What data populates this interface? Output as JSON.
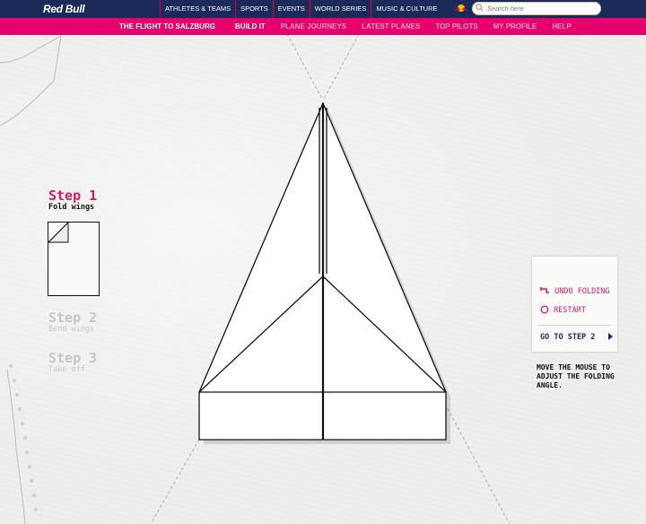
{
  "brand": {
    "logo": "Red Bull"
  },
  "topnav": {
    "items": [
      "ATHLETES & TEAMS",
      "SPORTS",
      "EVENTS",
      "WORLD SERIES",
      "MUSIC & CULTURE"
    ]
  },
  "search": {
    "placeholder": "Search here"
  },
  "subnav": {
    "title": "THE FLIGHT TO SALZBURG",
    "items": [
      "BUILD IT",
      "PLANE JOURNEYS",
      "LATEST PLANES",
      "TOP PILOTS",
      "MY PROFILE",
      "HELP"
    ],
    "active_index": 0
  },
  "steps": [
    {
      "title": "Step 1",
      "subtitle": "Fold wings",
      "active": true
    },
    {
      "title": "Step 2",
      "subtitle": "Bend wings",
      "active": false
    },
    {
      "title": "Step 3",
      "subtitle": "Take off",
      "active": false
    }
  ],
  "controls": {
    "undo_label": "UNDO FOLDING",
    "restart_label": "RESTART",
    "next_label": "GO TO STEP 2"
  },
  "instructions": "MOVE THE MOUSE TO ADJUST THE FOLDING ANGLE.",
  "colors": {
    "navy": "#1b2a59",
    "magenta": "#e5006e",
    "step_active": "#d61868",
    "step_inactive": "#c6c6c6"
  }
}
